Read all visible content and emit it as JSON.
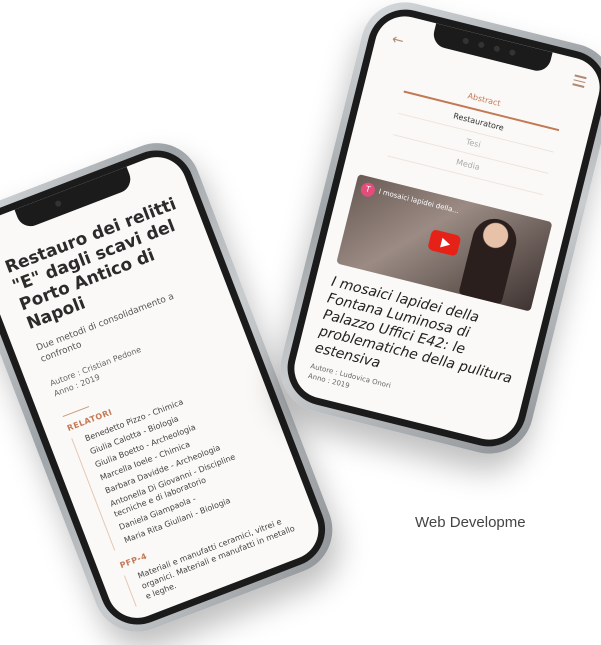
{
  "left_phone": {
    "title": "Restauro dei relitti \"E\" dagli scavi del Porto Antico di Napoli",
    "subtitle": "Due metodi di consolidamento a confronto",
    "author": "Autore : Cristian Pedone",
    "year": "Anno : 2019",
    "relatori_label": "RELATORI",
    "relatori": [
      "Benedetto Pizzo - Chimica",
      "Giulia Calotta - Biologia",
      "Giulia Boetto - Archeologia",
      "Marcella Ioele - Chimica",
      "Barbara Davidde - Archeologia",
      "Antonella Di Giovanni - Discipline tecniche e di laboratorio",
      "Daniela Giampaola -",
      "Maria Rita Giuliani - Biologia"
    ],
    "pfp_label": "PFP-4",
    "pfp_text": "Materiali e manufatti ceramici, vitrei e organici. Materiali e manufatti in metallo e leghe."
  },
  "right_phone": {
    "tabs": [
      "Abstract",
      "Restauratore",
      "Tesi",
      "Media"
    ],
    "video_avatar": "T",
    "video_title": "I mosaici lapidei della...",
    "title": "I mosaici lapidei della Fontana Luminosa di Palazzo Uffici E42: le problematiche della pulitura estensiva",
    "author": "Autore : Ludovica Onori",
    "year": "Anno : 2019"
  },
  "caption": "Web Developme",
  "colors": {
    "accent": "#c27a55",
    "screen_bg": "#fbf9f7"
  }
}
